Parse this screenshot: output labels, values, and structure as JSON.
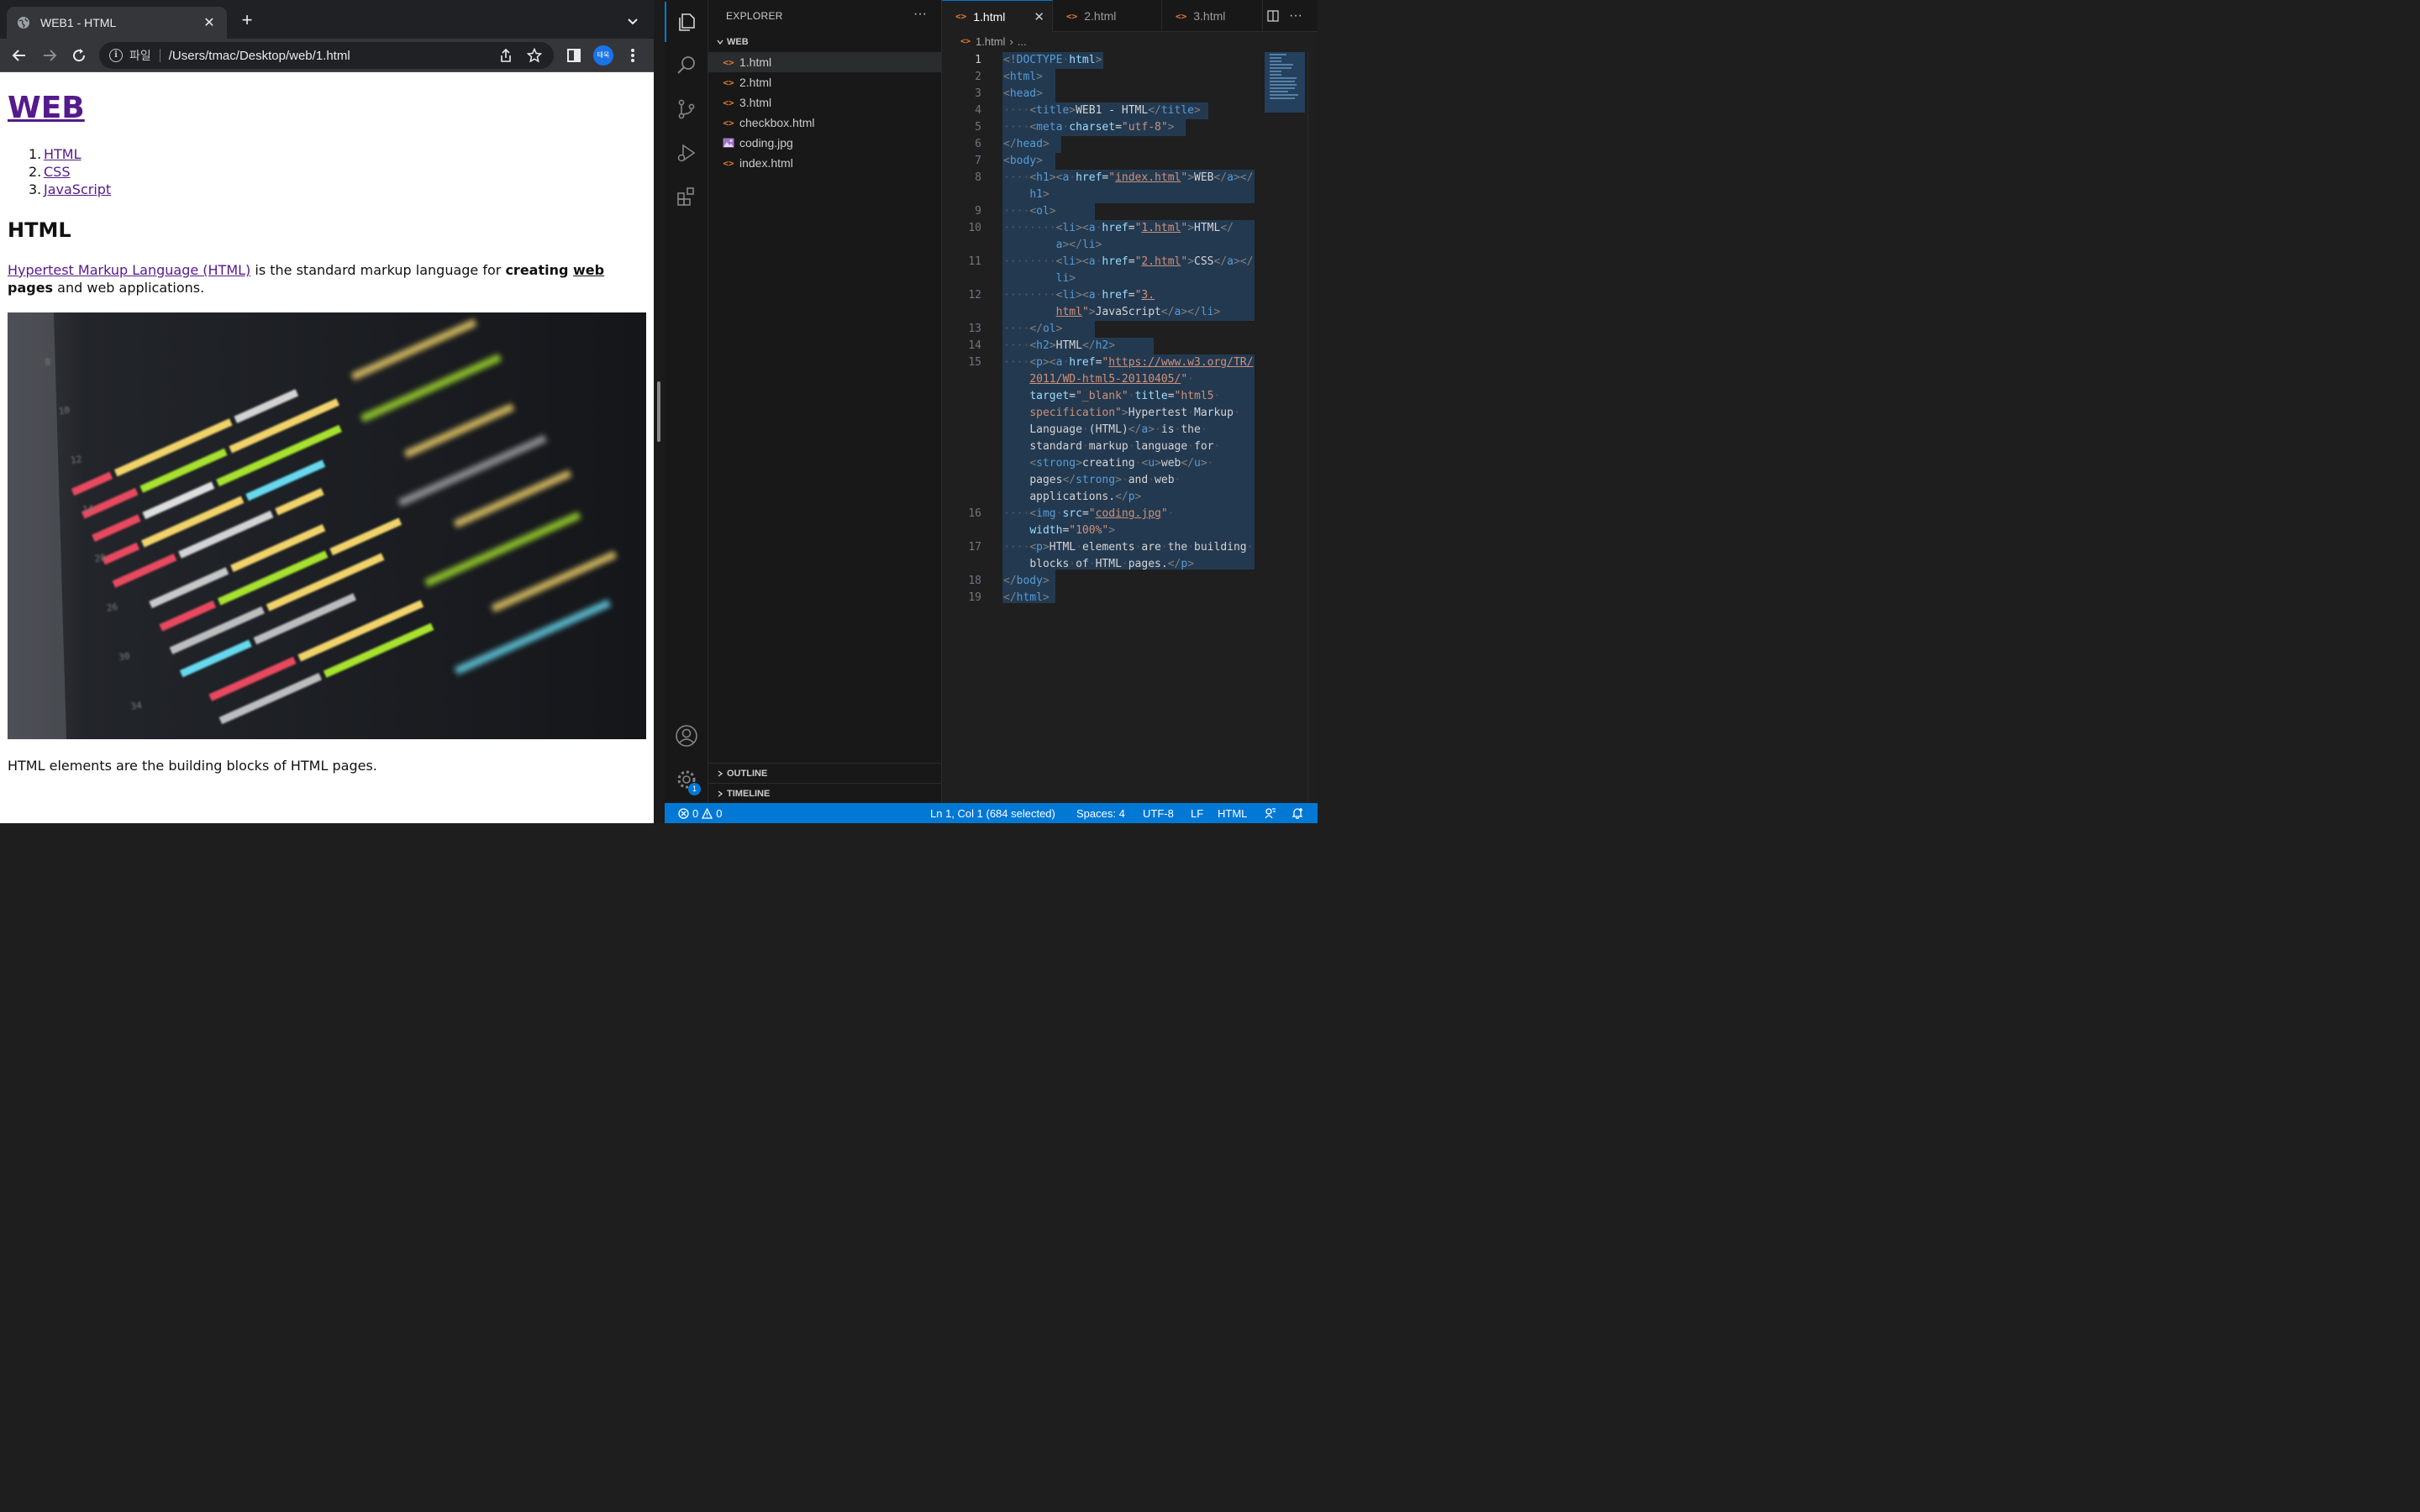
{
  "browser": {
    "tab_title": "WEB1 - HTML",
    "scheme_label": "파일",
    "url": "/Users/tmac/Desktop/web/1.html",
    "profile_label": "태욱"
  },
  "page": {
    "h1": "WEB",
    "list": [
      {
        "num": "1.",
        "text": "HTML"
      },
      {
        "num": "2.",
        "text": "CSS"
      },
      {
        "num": "3.",
        "text": "JavaScript"
      }
    ],
    "h2": "HTML",
    "p1_link": "Hypertest Markup Language (HTML)",
    "p1_a": " is the standard markup language for ",
    "p1_strong_a": "creating ",
    "p1_u": "web",
    "p1_strong_b": " pages",
    "p1_b": " and web applications.",
    "p2": "HTML elements are the building blocks of HTML pages."
  },
  "vscode": {
    "explorer_title": "EXPLORER",
    "folder": "WEB",
    "files": [
      {
        "name": "1.html",
        "type": "html",
        "selected": true
      },
      {
        "name": "2.html",
        "type": "html"
      },
      {
        "name": "3.html",
        "type": "html"
      },
      {
        "name": "checkbox.html",
        "type": "html"
      },
      {
        "name": "coding.jpg",
        "type": "image"
      },
      {
        "name": "index.html",
        "type": "html"
      }
    ],
    "outline": "OUTLINE",
    "timeline": "TIMELINE",
    "tabs": [
      {
        "name": "1.html",
        "active": true
      },
      {
        "name": "2.html"
      },
      {
        "name": "3.html"
      }
    ],
    "breadcrumb": "1.html",
    "breadcrumb_more": "...",
    "line_numbers": [
      "1",
      "2",
      "3",
      "4",
      "5",
      "6",
      "7",
      "8",
      "9",
      "10",
      "11",
      "12",
      "13",
      "14",
      "15",
      "16",
      "17",
      "18",
      "19"
    ],
    "status": {
      "errors": "0",
      "warnings": "0",
      "position": "Ln 1, Col 1 (684 selected)",
      "spaces": "Spaces: 4",
      "encoding": "UTF-8",
      "eol": "LF",
      "language": "HTML",
      "settings_badge": "1"
    },
    "colors": {
      "accent": "#0078d4",
      "tag": "#569cd6",
      "attr": "#9cdcfe",
      "string": "#ce9178",
      "selection": "#264f78"
    }
  }
}
